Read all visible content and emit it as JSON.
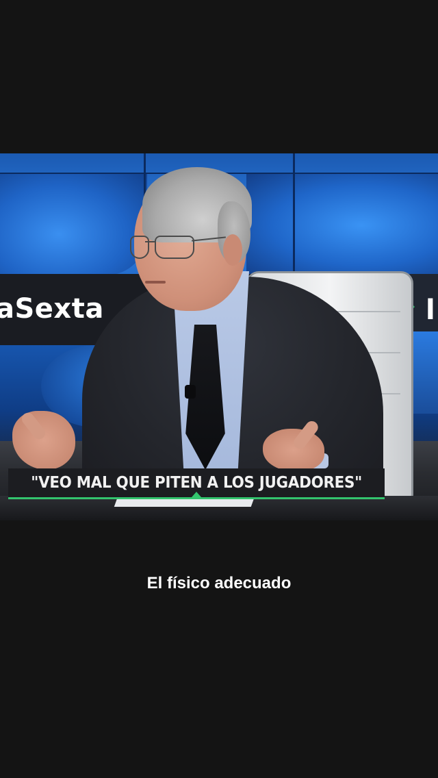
{
  "video": {
    "channel_logo": "aSexta",
    "channel_logo_fragment": "l",
    "lower_third_caption": "\"VEO MAL QUE PITEN A LOS JUGADORES\"",
    "accent_color": "#33c46e"
  },
  "subtitle": {
    "text": "El físico adecuado"
  },
  "colors": {
    "page_background": "#141414",
    "studio_blue": "#1f64c6"
  }
}
